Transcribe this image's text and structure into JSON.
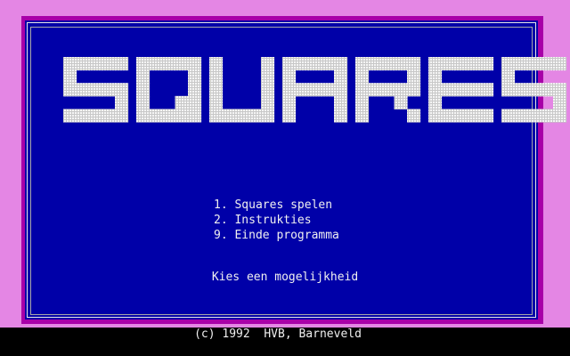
{
  "title": "SQUARES",
  "menu": {
    "items": [
      {
        "label": "1. Squares spelen"
      },
      {
        "label": "2. Instrukties"
      },
      {
        "label": "9. Einde programma"
      }
    ]
  },
  "prompt": "Kies een mogelijkheid",
  "footer": {
    "copyright": "(c) 1992  HVB, Barneveld"
  },
  "colors": {
    "border": "#c060c0",
    "panel": "#0000a8",
    "title_fill": "#e0e0e0",
    "text": "#f0f0f0",
    "background": "#000000"
  }
}
